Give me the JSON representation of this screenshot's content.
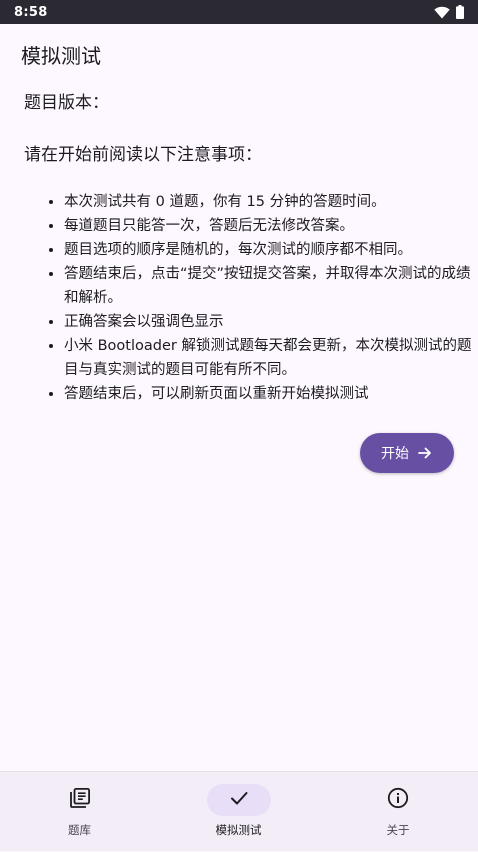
{
  "status_bar": {
    "time": "8:58",
    "icons": [
      "wifi-icon",
      "battery-icon"
    ]
  },
  "app_bar": {
    "title": "模拟测试"
  },
  "content": {
    "version_label": "题目版本：",
    "notice_heading": "请在开始前阅读以下注意事项：",
    "rules": [
      "本次测试共有 0 道题，你有 15 分钟的答题时间。",
      "每道题目只能答一次，答题后无法修改答案。",
      "题目选项的顺序是随机的，每次测试的顺序都不相同。",
      "答题结束后，点击“提交”按钮提交答案，并取得本次测试的成绩和解析。",
      "正确答案会以强调色显示",
      "小米 Bootloader 解锁测试题每天都会更新，本次模拟测试的题目与真实测试的题目可能有所不同。",
      "答题结束后，可以刷新页面以重新开始模拟测试"
    ],
    "start_button": {
      "label": "开始",
      "icon": "arrow-right-icon"
    }
  },
  "bottom_nav": {
    "items": [
      {
        "label": "题库",
        "icon": "library-icon",
        "active": false
      },
      {
        "label": "模拟测试",
        "icon": "check-icon",
        "active": true
      },
      {
        "label": "关于",
        "icon": "info-icon",
        "active": false
      }
    ]
  },
  "colors": {
    "background": "#fdf7ff",
    "status_bar": "#2b2a33",
    "primary": "#6750a4",
    "nav_background": "#f3edf7",
    "nav_indicator": "#e8def8",
    "text": "#1d1b20"
  }
}
